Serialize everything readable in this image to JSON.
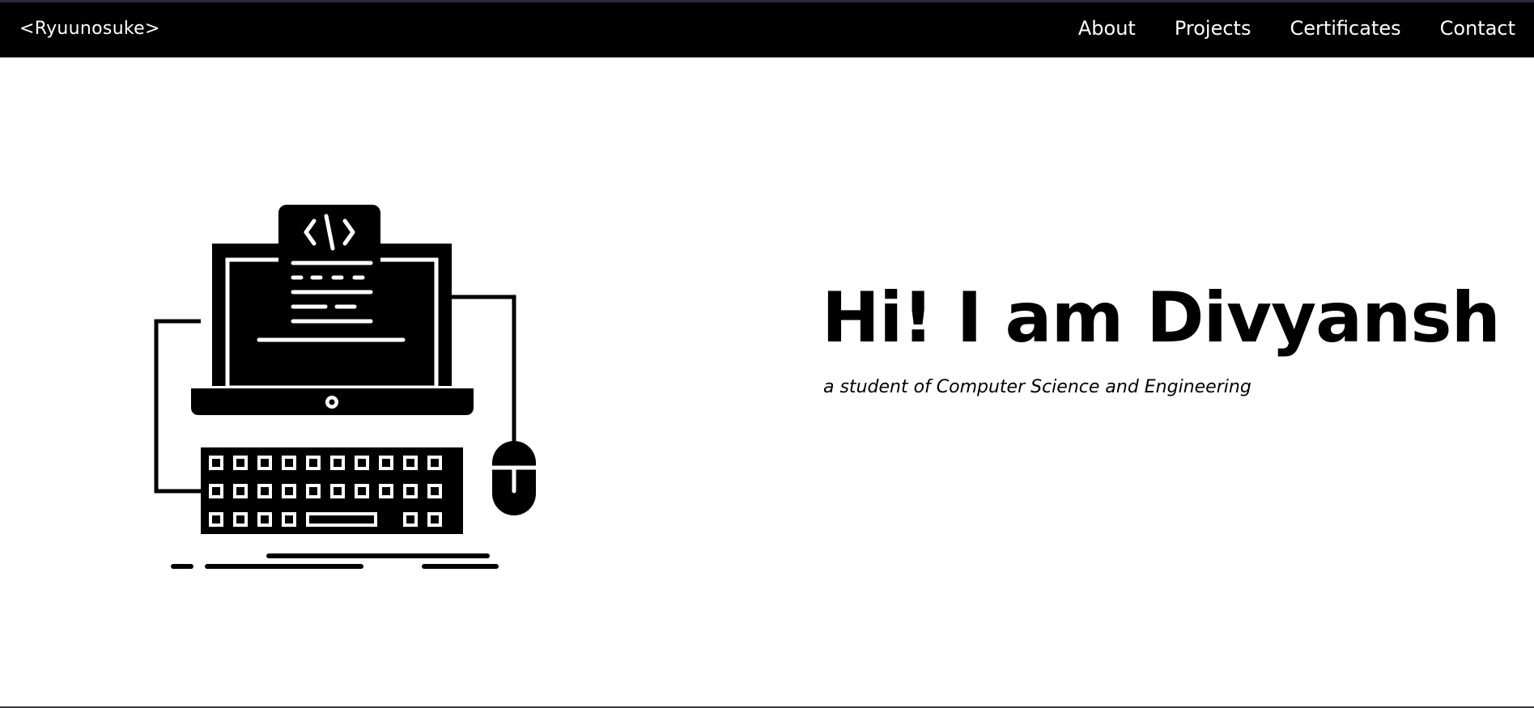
{
  "navbar": {
    "brand": "<Ryuunosuke>",
    "links": [
      {
        "label": "About"
      },
      {
        "label": "Projects"
      },
      {
        "label": "Certificates"
      },
      {
        "label": "Contact"
      }
    ]
  },
  "hero": {
    "illustration_icon": "laptop-code-keyboard-mouse-icon",
    "title": "Hi! I am Divyansh",
    "subtitle": "a student of Computer Science and Engineering"
  }
}
